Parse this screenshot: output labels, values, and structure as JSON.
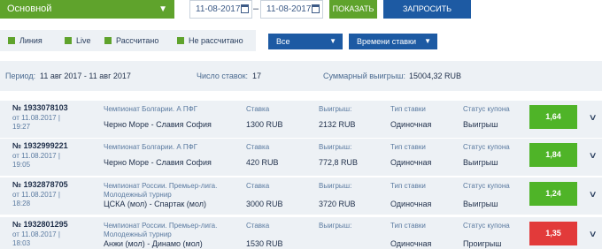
{
  "toolbar": {
    "type_select": "Основной",
    "date_from": "11-08-2017",
    "date_to": "11-08-2017",
    "date_separator": "–",
    "show_button": "ПОКАЗАТЬ",
    "history_button": "ЗАПРОСИТЬ ИСТОРИЮ"
  },
  "filters": {
    "checkboxes": [
      {
        "label": "Линия",
        "checked": true
      },
      {
        "label": "Live",
        "checked": true
      },
      {
        "label": "Рассчитано",
        "checked": true
      },
      {
        "label": "Не рассчитано",
        "checked": true
      }
    ],
    "dropdown_status": "Все",
    "dropdown_sort": "Времени ставки"
  },
  "summary": {
    "period_label": "Период:",
    "period_value": "11 авг 2017 - 11 авг 2017",
    "count_label": "Число ставок:",
    "count_value": "17",
    "total_label": "Суммарный выигрыш:",
    "total_value": "15004,32 RUB"
  },
  "headers": {
    "stake": "Ставка",
    "win": "Выигрыш:",
    "type": "Тип ставки",
    "status": "Статус купона"
  },
  "colors": {
    "green": "#4fb428",
    "red": "#e23a3a",
    "blue": "#1d5aa3"
  },
  "bets": [
    {
      "number": "№ 1933078103",
      "date": "от 11.08.2017 | 19:27",
      "championship": "Чемпионат Болгарии. А ПФГ",
      "match": "Черно Море - Славия София",
      "stake": "1300 RUB",
      "win": "2132 RUB",
      "type": "Одиночная",
      "status": "Выигрыш",
      "coef": "1,64",
      "result": "win"
    },
    {
      "number": "№ 1932999221",
      "date": "от 11.08.2017 | 19:05",
      "championship": "Чемпионат Болгарии. А ПФГ",
      "match": "Черно Море - Славия София",
      "stake": "420 RUB",
      "win": "772,8 RUB",
      "type": "Одиночная",
      "status": "Выигрыш",
      "coef": "1,84",
      "result": "win"
    },
    {
      "number": "№ 1932878705",
      "date": "от 11.08.2017 | 18:28",
      "championship": "Чемпионат России. Премьер-лига. Молодежный турнир",
      "match": "ЦСКА (мол) - Спартак (мол)",
      "stake": "3000 RUB",
      "win": "3720 RUB",
      "type": "Одиночная",
      "status": "Выигрыш",
      "coef": "1,24",
      "result": "win"
    },
    {
      "number": "№ 1932801295",
      "date": "от 11.08.2017 | 18:03",
      "championship": "Чемпионат России. Премьер-лига. Молодежный турнир",
      "match": "Анжи (мол) - Динамо (мол)",
      "stake": "1530 RUB",
      "win": "",
      "type": "Одиночная",
      "status": "Проигрыш",
      "coef": "1,35",
      "result": "lose"
    }
  ]
}
